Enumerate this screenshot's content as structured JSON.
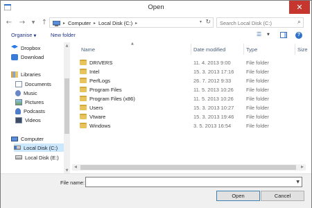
{
  "window": {
    "title": "Open",
    "close_glyph": "✕"
  },
  "nav": {
    "back_glyph": "←",
    "forward_glyph": "→",
    "recent_glyph": "▼",
    "up_glyph": "↑"
  },
  "address": {
    "crumbs": [
      "Computer",
      "Local Disk (C:)"
    ],
    "sep_glyph": "▸",
    "dropdown_glyph": "▾",
    "refresh_glyph": "↻"
  },
  "search": {
    "placeholder": "Search Local Disk (C:)",
    "icon_glyph": "⌕"
  },
  "toolbar": {
    "organise_label": "Organise",
    "organise_caret": "▼",
    "new_folder_label": "New folder",
    "views_glyph": "☰",
    "views_drop_glyph": "▼",
    "help_glyph": "?"
  },
  "sidebar": {
    "items": [
      {
        "label": "Dropbox",
        "icon": "dropbox-icon"
      },
      {
        "label": "Download",
        "icon": "download-icon"
      },
      {
        "label": "Libraries",
        "icon": "libraries-icon"
      },
      {
        "label": "Documents",
        "icon": "documents-icon"
      },
      {
        "label": "Music",
        "icon": "music-icon"
      },
      {
        "label": "Pictures",
        "icon": "pictures-icon"
      },
      {
        "label": "Podcasts",
        "icon": "podcasts-icon"
      },
      {
        "label": "Videos",
        "icon": "videos-icon"
      },
      {
        "label": "Computer",
        "icon": "computer-icon"
      },
      {
        "label": "Local Disk (C:)",
        "icon": "os-disk-icon",
        "selected": true
      },
      {
        "label": "Local Disk (E:)",
        "icon": "disk-icon"
      }
    ],
    "scroll_up_glyph": "▲",
    "scroll_down_glyph": "▼"
  },
  "files": {
    "columns": {
      "name": "Name",
      "date": "Date modified",
      "type": "Type",
      "size": "Size"
    },
    "sort_glyph": "▲",
    "rows": [
      {
        "name": "DRIVERS",
        "date": "11. 4. 2013 9:00",
        "type": "File folder"
      },
      {
        "name": "Intel",
        "date": "15. 3. 2013 17:16",
        "type": "File folder"
      },
      {
        "name": "PerfLogs",
        "date": "26. 7. 2012 9:33",
        "type": "File folder"
      },
      {
        "name": "Program Files",
        "date": "11. 5. 2013 10:26",
        "type": "File folder"
      },
      {
        "name": "Program Files (x86)",
        "date": "11. 5. 2013 10:26",
        "type": "File folder"
      },
      {
        "name": "Users",
        "date": "15. 3. 2013 10:27",
        "type": "File folder"
      },
      {
        "name": "Vtware",
        "date": "15. 3. 2013 19:46",
        "type": "File folder"
      },
      {
        "name": "Windows",
        "date": "3. 5. 2013 16:54",
        "type": "File folder"
      }
    ],
    "hscroll_left_glyph": "◀",
    "hscroll_right_glyph": "▶"
  },
  "footer": {
    "file_name_label": "File name:",
    "file_name_value": "",
    "dropdown_glyph": "▼",
    "open_label": "Open",
    "cancel_label": "Cancel"
  }
}
